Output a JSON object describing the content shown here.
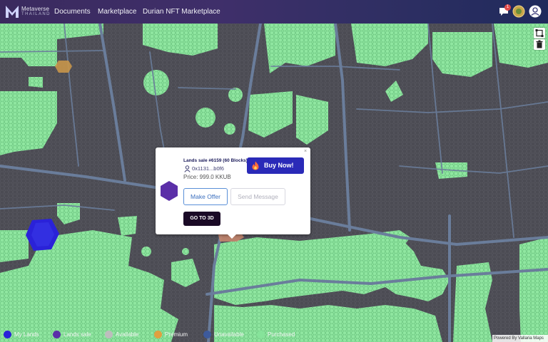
{
  "header": {
    "brand_name": "Metaverse",
    "brand_sub": "THAILAND",
    "nav": [
      "Documents",
      "Marketplace",
      "Durian NFT Marketplace"
    ],
    "notification_count": "1"
  },
  "popup": {
    "title": "Lands sale #6159 (60 Blocks)",
    "owner": "0x1131...b0f6",
    "price": "Price: 999.0 KKUB",
    "buy_label": "Buy Now!",
    "offer_label": "Make Offer",
    "message_label": "Send Message",
    "go3d_label": "GO TO 3D",
    "close": "×"
  },
  "legend": [
    {
      "label": "My Lands",
      "color": "#2a22d8"
    },
    {
      "label": "Lands sale",
      "color": "#5b2fa8"
    },
    {
      "label": "Available",
      "color": "#bdbdbd"
    },
    {
      "label": "Premium",
      "color": "#e0a040"
    },
    {
      "label": "Unavailable",
      "color": "#3d5a9c"
    },
    {
      "label": "Purchased",
      "color": "#86e39a"
    }
  ],
  "attribution": "Powered By Vallaria Maps",
  "colors": {
    "land_purchased": "#8fe6a0",
    "land_base": "#4b4b53",
    "road": "#5f6f88",
    "my_lands": "#2a22d8",
    "lands_sale": "#5b2fa8",
    "premium": "#c8964a"
  }
}
